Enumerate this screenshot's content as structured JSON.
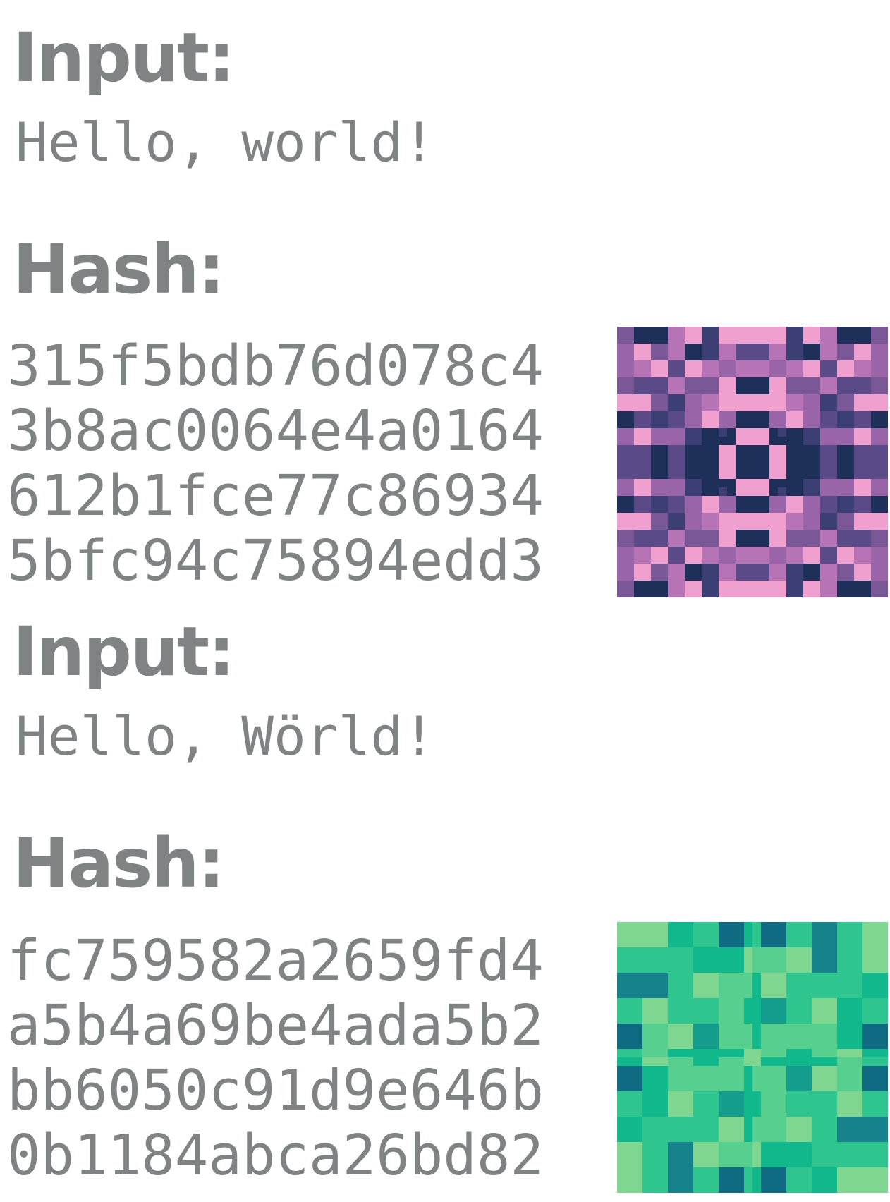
{
  "entries": [
    {
      "input_label": "Input:",
      "input_text": "Hello, world!",
      "hash_label": "Hash:",
      "hash_lines": [
        "315f5bdb76d078c4",
        "3b8ac0064e4a0164",
        "612b1fce77c86934",
        "5bfc94c75894edd3"
      ],
      "identicon": {
        "colors": [
          "#1e2f5a",
          "#3b3f74",
          "#5a4a88",
          "#7a5898",
          "#9a64a8",
          "#b673b6",
          "#f0a0cf"
        ]
      }
    },
    {
      "input_label": "Input:",
      "input_text": "Hello, Wörld!",
      "hash_label": "Hash:",
      "hash_lines": [
        "fc759582a2659fd4",
        "a5b4a69be4ada5b2",
        "bb6050c91d9e646b",
        "0b1184abca26bd82"
      ],
      "identicon": {
        "colors": [
          "#0f6b82",
          "#16838c",
          "#149c8c",
          "#11b88b",
          "#2ec58f",
          "#57cf8f",
          "#7fd690"
        ]
      }
    }
  ]
}
